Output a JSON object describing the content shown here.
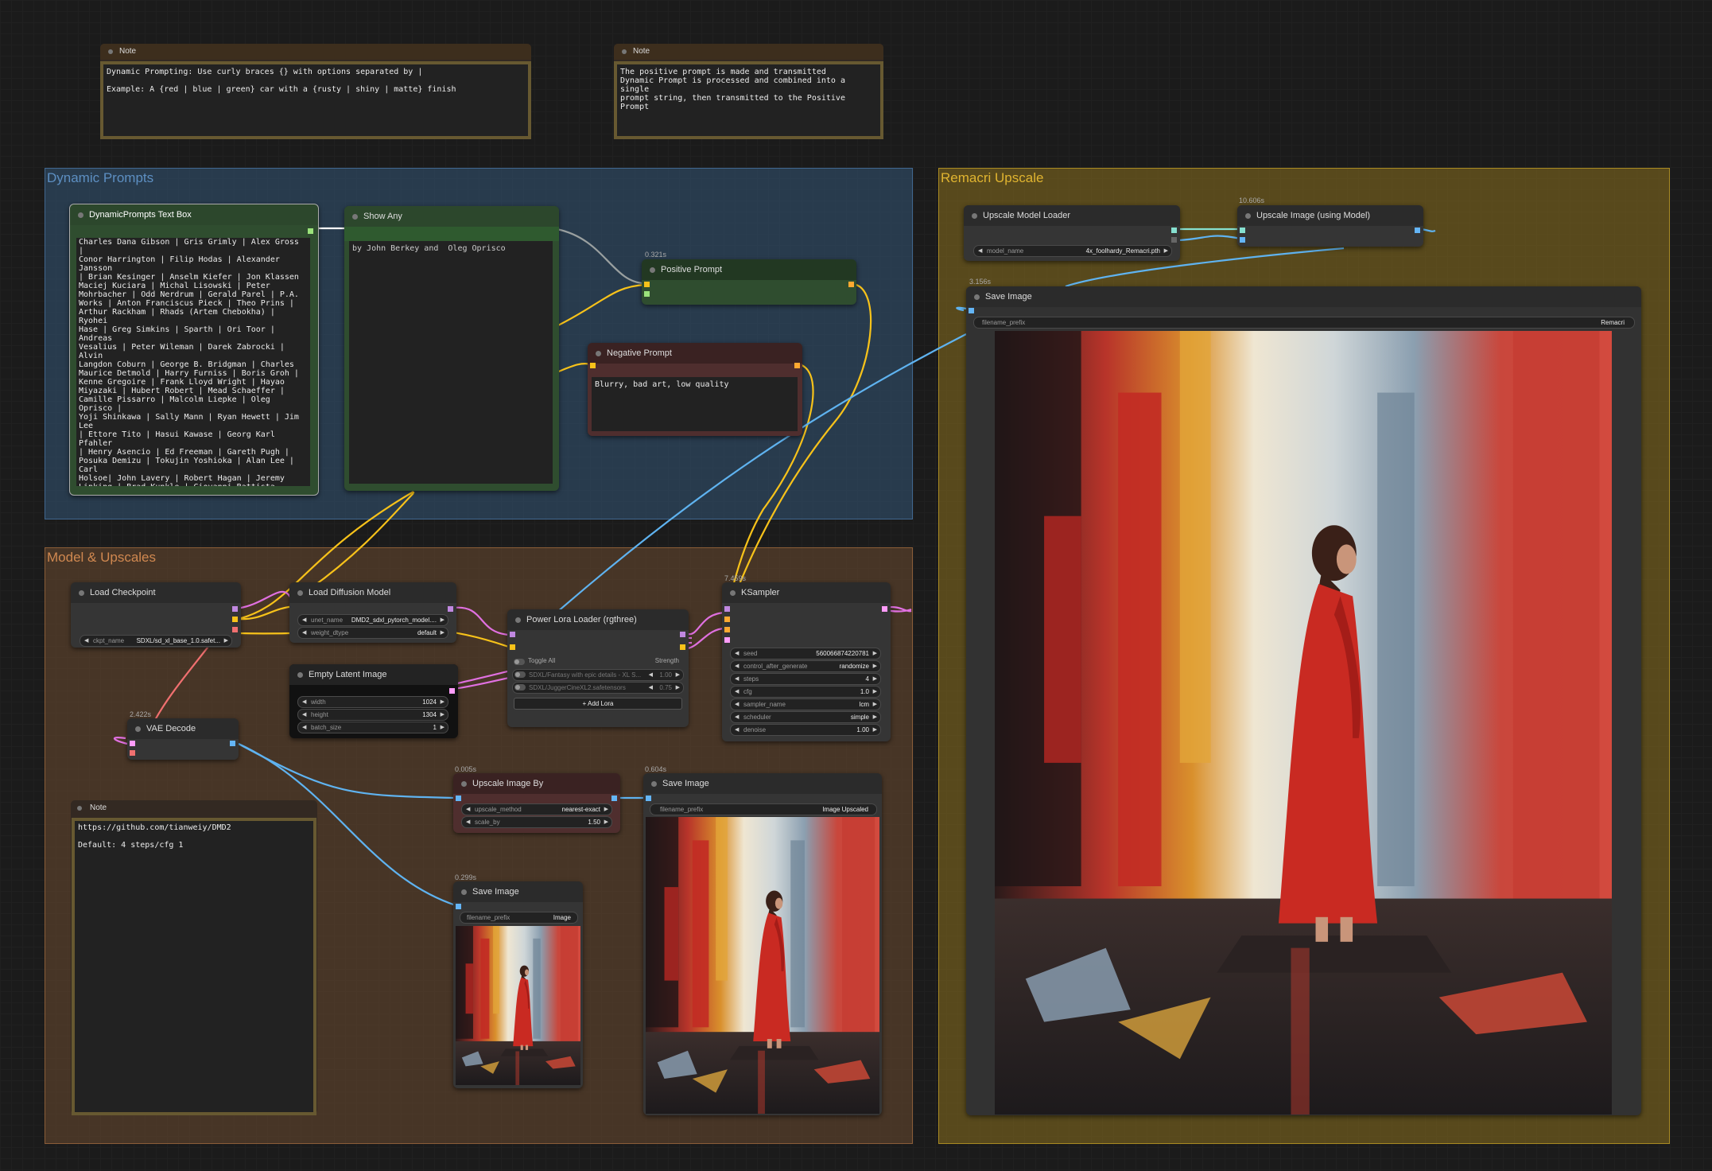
{
  "canvas": {
    "background": "#1b1b1b"
  },
  "notes": {
    "top_left": {
      "title": "Note",
      "text": "Dynamic Prompting: Use curly braces {} with options separated by |\n\nExample: A {red | blue | green} car with a {rusty | shiny | matte} finish"
    },
    "top_right": {
      "title": "Note",
      "text": "The positive prompt is made and transmitted\nDynamic Prompt is processed and combined into a single\nprompt string, then transmitted to the Positive Prompt"
    },
    "bottom": {
      "title": "Note",
      "text": "https://github.com/tianweiy/DMD2\n\nDefault: 4 steps/cfg 1"
    }
  },
  "groups": {
    "dynamic_prompts": {
      "title": "Dynamic Prompts",
      "color": "#335577"
    },
    "model_upscales": {
      "title": "Model & Upscales",
      "color": "#6b4a2f"
    },
    "remacri_upscale": {
      "title": "Remacri Upscale",
      "color": "#8a6f1e"
    }
  },
  "nodes": {
    "dynamic_prompts_text_box": {
      "title": "DynamicPrompts Text Box",
      "text": "Charles Dana Gibson | Gris Grimly | Alex Gross |\nConor Harrington | Filip Hodas | Alexander Jansson\n| Brian Kesinger | Anselm Kiefer | Jon Klassen\nMaciej Kuciara | Michal Lisowski | Peter\nMohrbacher | Odd Nerdrum | Gerald Parel | P.A.\nWorks | Anton Franciscus Pieck | Theo Prins |\nArthur Rackham | Rhads (Artem Chebokha) | Ryohei\nHase | Greg Simkins | Sparth | Ori Toor | Andreas\nVesalius | Peter Wileman | Darek Zabrocki | Alvin\nLangdon Coburn | George B. Bridgman | Charles\nMaurice Detmold | Harry Furniss | Boris Groh |\nKenne Gregoire | Frank Lloyd Wright | Hayao\nMiyazaki | Hubert Robert | Mead Schaeffer |\nCamille Pissarro | Malcolm Liepke | Oleg Oprisco |\nYoji Shinkawa | Sally Mann | Ryan Hewett | Jim Lee\n| Ettore Tito | Hasui Kawase | Georg Karl Pfahler\n| Henry Asencio | Ed Freeman | Gareth Pugh |\nPosuka Demizu | Tokujin Yoshioka | Alan Lee | Carl\nHolsoe| John Lavery | Robert Hagan | Jeremy\nLipking | Brad Kunkle | Giovanni Battista Piranesi\n| Henry Moore | Howard Chandler Christy| Hugh\nKretschmer | Iain Faulkner | Igor Zenin | Itō\nJakuchū | Ivan Shishkin | Jean Nouvel | Joel\nSternfeld | John Philip Falter | Kentaro Miura |\nNathan Wirth | Norman Foster | Raymond Leech |\nYang Jialun | William Eggleston | Tsutomu Nihei |\nTim Doyle | Sou Fujimoto | Slim Aarons | Bella\nKotak }"
    },
    "show_any": {
      "title": "Show Any",
      "text": "by John Berkey and  Oleg Oprisco"
    },
    "positive_prompt": {
      "title": "Positive Prompt",
      "timing": "0.321s"
    },
    "negative_prompt": {
      "title": "Negative Prompt",
      "text": "Blurry, bad art, low quality"
    },
    "load_checkpoint": {
      "title": "Load Checkpoint",
      "ckpt_label": "ckpt_name",
      "ckpt_value": "SDXL/sd_xl_base_1.0.safet..."
    },
    "load_diffusion_model": {
      "title": "Load Diffusion Model",
      "unet_label": "unet_name",
      "unet_value": "DMD2_sdxl_pytorch_model....",
      "dtype_label": "weight_dtype",
      "dtype_value": "default"
    },
    "empty_latent": {
      "title": "Empty Latent Image",
      "width_label": "width",
      "width_value": "1024",
      "height_label": "height",
      "height_value": "1304",
      "batch_label": "batch_size",
      "batch_value": "1"
    },
    "vae_decode": {
      "title": "VAE Decode",
      "timing": "2.422s"
    },
    "power_lora": {
      "title": "Power Lora Loader (rgthree)",
      "toggle_all": "Toggle All",
      "strength": "Strength",
      "lora1": "SDXL/Fantasy with epic details - XL S...",
      "lora1_value": "1.00",
      "lora2": "SDXL/JuggerCineXL2.safetensors",
      "lora2_value": "0.75",
      "add_lora": "Add Lora"
    },
    "ksampler": {
      "title": "KSampler",
      "timing": "7.459s",
      "widgets": [
        {
          "label": "seed",
          "value": "560066874220781"
        },
        {
          "label": "control_after_generate",
          "value": "randomize"
        },
        {
          "label": "steps",
          "value": "4"
        },
        {
          "label": "cfg",
          "value": "1.0"
        },
        {
          "label": "sampler_name",
          "value": "lcm"
        },
        {
          "label": "scheduler",
          "value": "simple"
        },
        {
          "label": "denoise",
          "value": "1.00"
        }
      ]
    },
    "upscale_by": {
      "title": "Upscale Image By",
      "timing": "0.005s",
      "method_label": "upscale_method",
      "method_value": "nearest-exact",
      "scale_label": "scale_by",
      "scale_value": "1.50"
    },
    "save_image_small": {
      "title": "Save Image",
      "timing": "0.299s",
      "prefix_label": "filename_prefix",
      "prefix_value": "Image"
    },
    "save_image_mid": {
      "title": "Save Image",
      "timing": "0.604s",
      "prefix_label": "filename_prefix",
      "prefix_value": "Image Upscaled"
    },
    "upscale_model_loader": {
      "title": "Upscale Model Loader",
      "model_label": "model_name",
      "model_value": "4x_foolhardy_Remacri.pth"
    },
    "upscale_with_model": {
      "title": "Upscale Image (using Model)",
      "timing": "10.606s"
    },
    "save_image_large": {
      "title": "Save Image",
      "timing": "3.156s",
      "prefix_label": "filename_prefix",
      "prefix_value": "Remacri"
    }
  }
}
